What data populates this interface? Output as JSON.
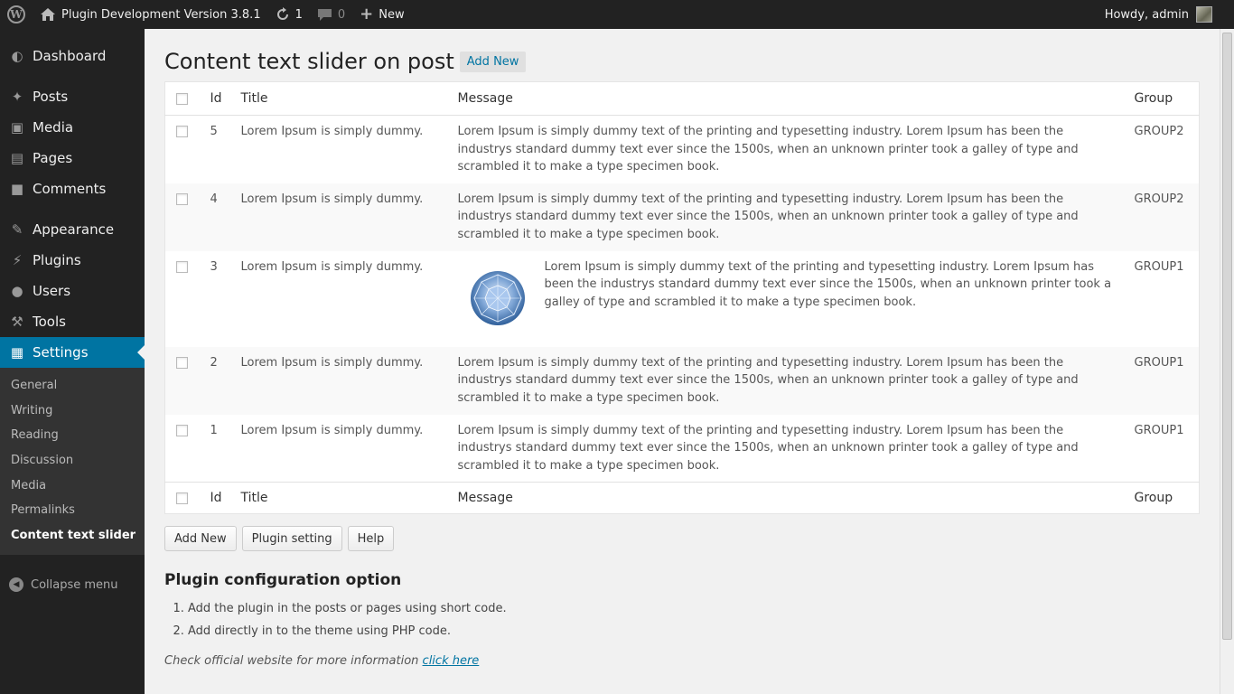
{
  "adminbar": {
    "site_title": "Plugin Development Version 3.8.1",
    "updates_count": "1",
    "comments_count": "0",
    "new_label": "New",
    "howdy": "Howdy, admin"
  },
  "sidebar": {
    "items": [
      {
        "label": "Dashboard",
        "icon": "dashboard-icon"
      },
      {
        "label": "Posts",
        "icon": "pin-icon"
      },
      {
        "label": "Media",
        "icon": "media-icon"
      },
      {
        "label": "Pages",
        "icon": "pages-icon"
      },
      {
        "label": "Comments",
        "icon": "comment-icon"
      },
      {
        "label": "Appearance",
        "icon": "brush-icon"
      },
      {
        "label": "Plugins",
        "icon": "plug-icon"
      },
      {
        "label": "Users",
        "icon": "user-icon"
      },
      {
        "label": "Tools",
        "icon": "wrench-icon"
      },
      {
        "label": "Settings",
        "icon": "settings-icon"
      }
    ],
    "submenu": [
      "General",
      "Writing",
      "Reading",
      "Discussion",
      "Media",
      "Permalinks",
      "Content text slider"
    ],
    "collapse": "Collapse menu"
  },
  "page": {
    "title": "Content text slider on post",
    "add_new": "Add New"
  },
  "table": {
    "headers": {
      "id": "Id",
      "title": "Title",
      "message": "Message",
      "group": "Group"
    },
    "rows": [
      {
        "id": "5",
        "title": "Lorem Ipsum is simply dummy.",
        "message": "Lorem Ipsum is simply dummy text of the printing and typesetting industry. Lorem Ipsum has been the industrys standard dummy text ever since the 1500s, when an unknown printer took a galley of type and scrambled it to make a type specimen book.",
        "group": "GROUP2"
      },
      {
        "id": "4",
        "title": "Lorem Ipsum is simply dummy.",
        "message": "Lorem Ipsum is simply dummy text of the printing and typesetting industry. Lorem Ipsum has been the industrys standard dummy text ever since the 1500s, when an unknown printer took a galley of type and scrambled it to make a type specimen book.",
        "group": "GROUP2"
      },
      {
        "id": "3",
        "title": "Lorem Ipsum is simply dummy.",
        "message": "Lorem Ipsum is simply dummy text of the printing and typesetting industry. Lorem Ipsum has been the industrys standard dummy text ever since the 1500s, when an unknown printer took a galley of type and scrambled it to make a type specimen book.",
        "group": "GROUP1"
      },
      {
        "id": "2",
        "title": "Lorem Ipsum is simply dummy.",
        "message": "Lorem Ipsum is simply dummy text of the printing and typesetting industry. Lorem Ipsum has been the industrys standard dummy text ever since the 1500s, when an unknown printer took a galley of type and scrambled it to make a type specimen book.",
        "group": "GROUP1"
      },
      {
        "id": "1",
        "title": "Lorem Ipsum is simply dummy.",
        "message": "Lorem Ipsum is simply dummy text of the printing and typesetting industry. Lorem Ipsum has been the industrys standard dummy text ever since the 1500s, when an unknown printer took a galley of type and scrambled it to make a type specimen book.",
        "group": "GROUP1"
      }
    ]
  },
  "buttons": {
    "add_new": "Add New",
    "plugin_setting": "Plugin setting",
    "help": "Help"
  },
  "config": {
    "heading": "Plugin configuration option",
    "steps": [
      "Add the plugin in the posts or pages using short code.",
      "Add directly in to the theme using PHP code."
    ],
    "note_text": "Check official website for more information",
    "note_link": "click here"
  },
  "colors": {
    "accent": "#0074a2",
    "adminbar": "#222222",
    "background": "#f1f1f1"
  }
}
